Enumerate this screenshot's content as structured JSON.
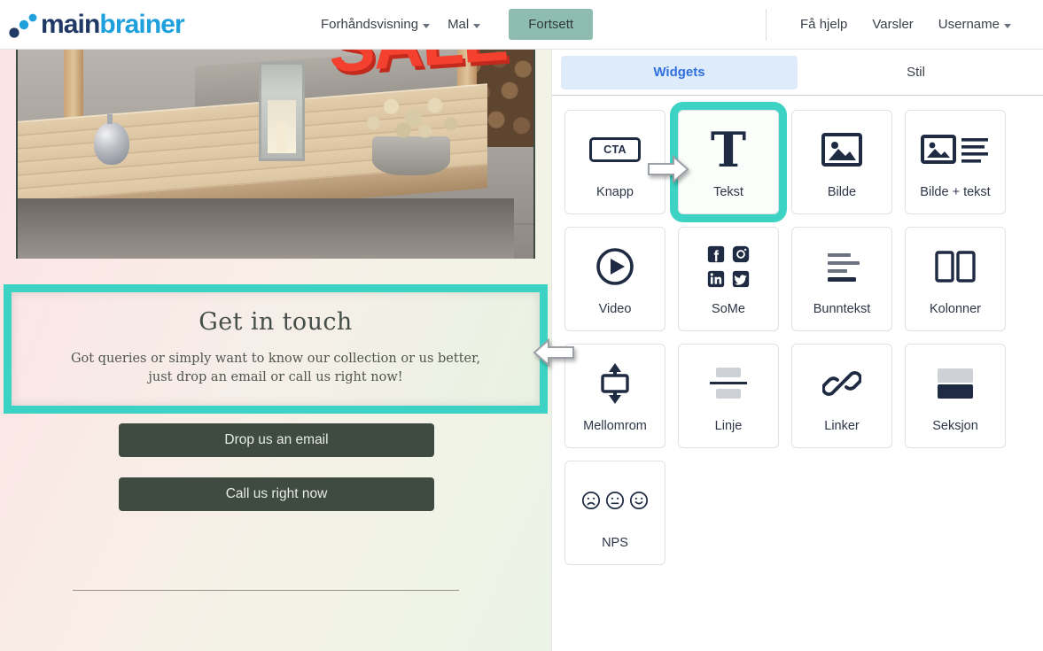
{
  "brand": {
    "logo_main": "main",
    "logo_brainer": "brainer",
    "accent_blue": "#1ea0dd",
    "navy": "#1f3864",
    "teal_selection": "#3dd3c4",
    "continue_green": "#8fbcb0",
    "tab_active_blue": "#2f6fde"
  },
  "topbar": {
    "nav_center": [
      {
        "label": "Forhåndsvisning",
        "has_caret": true,
        "icon": "chevron-down-icon"
      },
      {
        "label": "Mal",
        "has_caret": true,
        "icon": "chevron-down-icon"
      }
    ],
    "continue_button": "Fortsett",
    "nav_right": [
      {
        "label": "Få hjelp",
        "has_caret": false
      },
      {
        "label": "Varsler",
        "has_caret": false
      },
      {
        "label": "Username",
        "has_caret": true,
        "icon": "chevron-down-icon"
      }
    ]
  },
  "panel": {
    "tabs": [
      {
        "label": "Widgets",
        "active": true
      },
      {
        "label": "Stil",
        "active": false
      }
    ],
    "widgets": [
      {
        "label": "Knapp",
        "icon": "cta-button-icon",
        "badge": "CTA",
        "selected": false
      },
      {
        "label": "Tekst",
        "icon": "text-T-icon",
        "selected": true
      },
      {
        "label": "Bilde",
        "icon": "image-icon",
        "selected": false
      },
      {
        "label": "Bilde + tekst",
        "icon": "image-text-icon",
        "selected": false
      },
      {
        "label": "Video",
        "icon": "play-circle-icon",
        "selected": false
      },
      {
        "label": "SoMe",
        "icon": "social-media-icon",
        "selected": false
      },
      {
        "label": "Bunntekst",
        "icon": "footer-lines-icon",
        "selected": false
      },
      {
        "label": "Kolonner",
        "icon": "two-columns-icon",
        "selected": false
      },
      {
        "label": "Mellomrom",
        "icon": "spacer-arrows-icon",
        "selected": false
      },
      {
        "label": "Linje",
        "icon": "divider-line-icon",
        "selected": false
      },
      {
        "label": "Linker",
        "icon": "chain-link-icon",
        "selected": false
      },
      {
        "label": "Seksjon",
        "icon": "section-blocks-icon",
        "selected": false
      },
      {
        "label": "NPS",
        "icon": "nps-faces-icon",
        "selected": false
      }
    ]
  },
  "canvas": {
    "hero_image": {
      "alt": "wooden deck bench with teapot lantern and flower pot",
      "overlay_text": "SALE",
      "frame_color": "#3e4a42"
    },
    "selected_text_block": {
      "heading": "Get in touch",
      "body_line_1": "Got queries or simply want to know our collection or us better,",
      "body_line_2": "just drop an email or call us right now!",
      "is_selected": true
    },
    "buttons": [
      {
        "label": "Drop us an email"
      },
      {
        "label": "Call us right now"
      }
    ],
    "cursors": [
      {
        "name": "drag-cursor-left",
        "direction": "left"
      },
      {
        "name": "drag-cursor-right",
        "direction": "right"
      }
    ]
  }
}
